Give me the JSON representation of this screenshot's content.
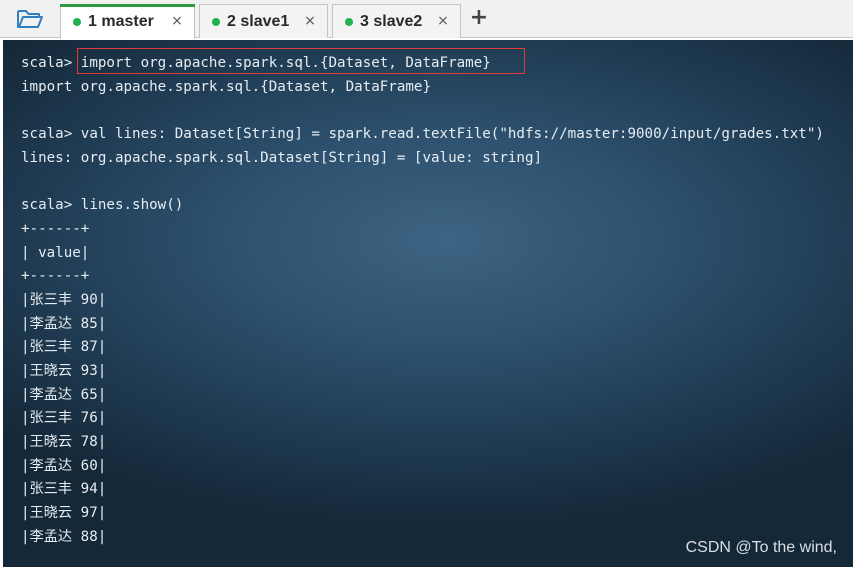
{
  "tabs": [
    {
      "label": "1 master",
      "active": true,
      "status_color": "#22b14c"
    },
    {
      "label": "2 slave1",
      "active": false,
      "status_color": "#22b14c"
    },
    {
      "label": "3 slave2",
      "active": false,
      "status_color": "#22b14c"
    }
  ],
  "tab_close_glyph": "×",
  "add_tab_glyph": "+",
  "icons": {
    "open_folder": "folder-open-icon"
  },
  "colors": {
    "active_tab_accent": "#2b9a3f",
    "highlight_box": "#e03a3a",
    "terminal_text": "#e6edf2"
  },
  "terminal": {
    "lines": [
      {
        "prompt": "scala> ",
        "text": "import org.apache.spark.sql.{Dataset, DataFrame}"
      },
      {
        "prompt": "",
        "text": "import org.apache.spark.sql.{Dataset, DataFrame}"
      },
      {
        "prompt": "",
        "text": ""
      },
      {
        "prompt": "scala> ",
        "text": "val lines: Dataset[String] = spark.read.textFile(\"hdfs://master:9000/input/grades.txt\")"
      },
      {
        "prompt": "",
        "text": "lines: org.apache.spark.sql.Dataset[String] = [value: string]"
      },
      {
        "prompt": "",
        "text": ""
      },
      {
        "prompt": "scala> ",
        "text": "lines.show()"
      },
      {
        "prompt": "",
        "text": "+------+"
      },
      {
        "prompt": "",
        "text": "| value|"
      },
      {
        "prompt": "",
        "text": "+------+"
      },
      {
        "prompt": "",
        "text": "|张三丰 90|"
      },
      {
        "prompt": "",
        "text": "|李孟达 85|"
      },
      {
        "prompt": "",
        "text": "|张三丰 87|"
      },
      {
        "prompt": "",
        "text": "|王晓云 93|"
      },
      {
        "prompt": "",
        "text": "|李孟达 65|"
      },
      {
        "prompt": "",
        "text": "|张三丰 76|"
      },
      {
        "prompt": "",
        "text": "|王晓云 78|"
      },
      {
        "prompt": "",
        "text": "|李孟达 60|"
      },
      {
        "prompt": "",
        "text": "|张三丰 94|"
      },
      {
        "prompt": "",
        "text": "|王晓云 97|"
      },
      {
        "prompt": "",
        "text": "|李孟达 88|"
      }
    ]
  },
  "watermark": "CSDN @To the wind,"
}
